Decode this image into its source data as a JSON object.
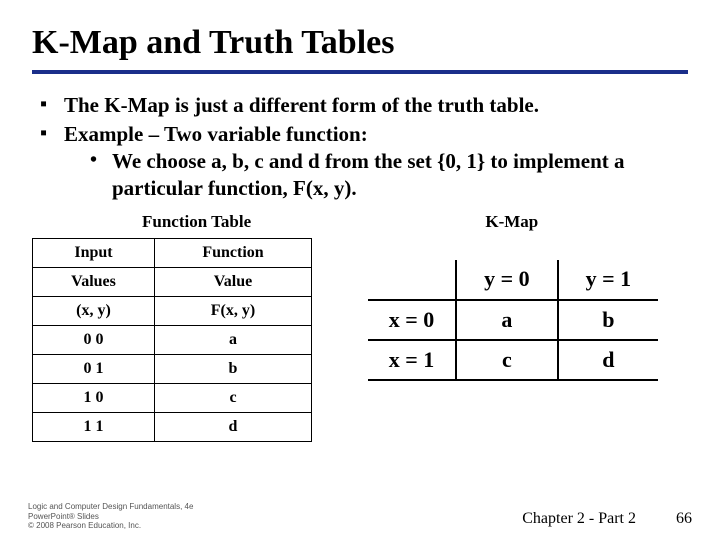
{
  "title": "K-Map and Truth Tables",
  "bullets": {
    "b1": "The K-Map is just a different form of the truth table.",
    "b2": "Example – Two variable function:",
    "b2a": "We choose a, b, c and d from the set {0, 1} to implement a particular function, F(x, y)."
  },
  "labels": {
    "func_table": "Function Table",
    "kmap": "K-Map"
  },
  "func_table": {
    "h1a": "Input",
    "h1b": "Function",
    "h2a": "Values",
    "h2b": "Value",
    "h3a": "(x, y)",
    "h3b": "F(x, y)",
    "rows": [
      {
        "xy": "0 0",
        "f": "a"
      },
      {
        "xy": "0 1",
        "f": "b"
      },
      {
        "xy": "1 0",
        "f": "c"
      },
      {
        "xy": "1 1",
        "f": "d"
      }
    ]
  },
  "kmap": {
    "y0": "y = 0",
    "y1": "y = 1",
    "x0": "x = 0",
    "x1": "x = 1",
    "c00": "a",
    "c01": "b",
    "c10": "c",
    "c11": "d"
  },
  "footer": {
    "chapter": "Chapter 2 - Part 2",
    "page": "66",
    "copyright1": "Logic and Computer Design Fundamentals, 4e",
    "copyright2": "PowerPoint® Slides",
    "copyright3": "© 2008 Pearson Education, Inc."
  }
}
